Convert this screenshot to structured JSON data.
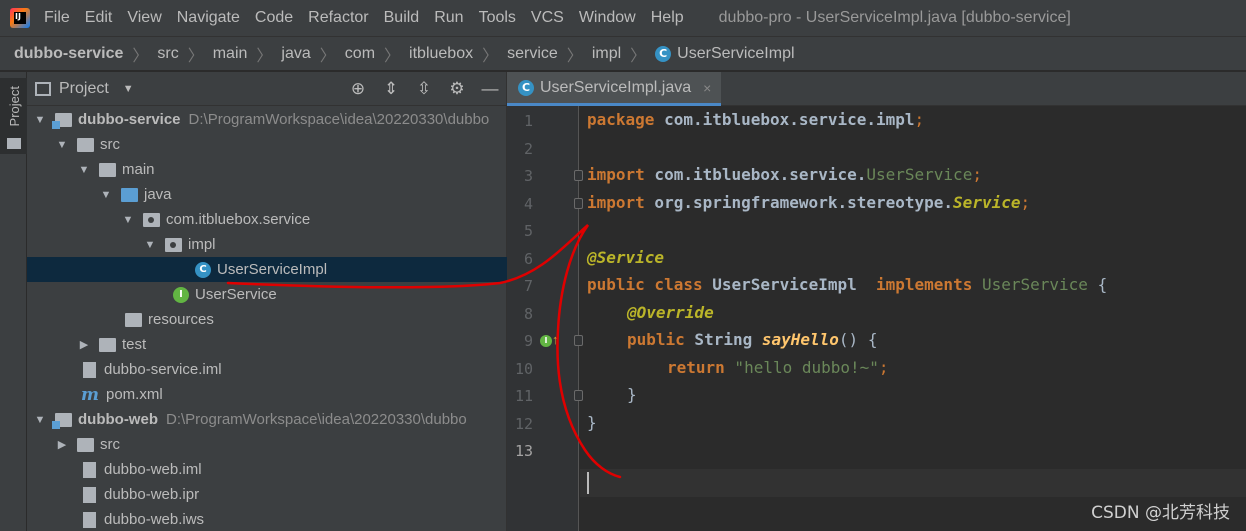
{
  "menubar": {
    "logo": "IJ",
    "items": [
      "File",
      "Edit",
      "View",
      "Navigate",
      "Code",
      "Refactor",
      "Build",
      "Run",
      "Tools",
      "VCS",
      "Window",
      "Help"
    ],
    "window_title": "dubbo-pro - UserServiceImpl.java [dubbo-service]"
  },
  "breadcrumb": {
    "items": [
      "dubbo-service",
      "src",
      "main",
      "java",
      "com",
      "itbluebox",
      "service",
      "impl"
    ],
    "current": "UserServiceImpl",
    "current_icon": "C"
  },
  "toolstrip": {
    "project_label": "Project"
  },
  "project_panel": {
    "title": "Project",
    "tools": [
      "locate-icon",
      "expand-all-icon",
      "collapse-all-icon",
      "gear-icon",
      "minimize-icon"
    ],
    "tree": [
      {
        "label": "dubbo-service",
        "path": "D:\\ProgramWorkspace\\idea\\20220330\\dubbo",
        "kind": "module",
        "expanded": true,
        "level": 0
      },
      {
        "label": "src",
        "kind": "folder",
        "expanded": true,
        "level": 1
      },
      {
        "label": "main",
        "kind": "folder",
        "expanded": true,
        "level": 2
      },
      {
        "label": "java",
        "kind": "source-folder",
        "expanded": true,
        "level": 3
      },
      {
        "label": "com.itbluebox.service",
        "kind": "package",
        "expanded": true,
        "level": 4
      },
      {
        "label": "impl",
        "kind": "package",
        "expanded": true,
        "level": 5
      },
      {
        "label": "UserServiceImpl",
        "kind": "class",
        "level": 6,
        "selected": true,
        "icon": "C"
      },
      {
        "label": "UserService",
        "kind": "interface",
        "level": 5,
        "icon": "I"
      },
      {
        "label": "resources",
        "kind": "resources-folder",
        "level": 3
      },
      {
        "label": "test",
        "kind": "folder",
        "expanded": false,
        "level": 2
      },
      {
        "label": "dubbo-service.iml",
        "kind": "file",
        "level": 2
      },
      {
        "label": "pom.xml",
        "kind": "maven",
        "level": 2,
        "icon": "m"
      },
      {
        "label": "dubbo-web",
        "path": "D:\\ProgramWorkspace\\idea\\20220330\\dubbo",
        "kind": "module",
        "expanded": true,
        "level": 0
      },
      {
        "label": "src",
        "kind": "folder",
        "expanded": false,
        "level": 1
      },
      {
        "label": "dubbo-web.iml",
        "kind": "file",
        "level": 2
      },
      {
        "label": "dubbo-web.ipr",
        "kind": "file",
        "level": 2
      },
      {
        "label": "dubbo-web.iws",
        "kind": "file",
        "level": 2
      }
    ]
  },
  "editor": {
    "tab": {
      "label": "UserServiceImpl.java",
      "icon": "C",
      "close": "×"
    },
    "line_numbers": [
      "1",
      "2",
      "3",
      "4",
      "5",
      "6",
      "7",
      "8",
      "9",
      "10",
      "11",
      "12",
      "13"
    ],
    "current_line": "13",
    "gutter_icon": "I",
    "gutter_arrow": "↑",
    "code": {
      "l1_kw": "package",
      "l1_rest": " com.itbluebox.service.impl",
      "l1_semi": ";",
      "l3_kw": "import",
      "l3_pkg": " com.itbluebox.service.",
      "l3_cls": "UserService",
      "l3_semi": ";",
      "l4_kw": "import",
      "l4_pkg": " org.springframework.stereotype.",
      "l4_cls": "Service",
      "l4_semi": ";",
      "l6_ann": "@Service",
      "l7_kw1": "public",
      "l7_kw2": " class ",
      "l7_cls": "UserServiceImpl",
      "l7_kw3": "  implements ",
      "l7_ifc": "UserService",
      "l7_rest": " {",
      "l8_ann": "@Override",
      "l9_kw": "public",
      "l9_type": " String ",
      "l9_meth": "sayHello",
      "l9_rest": "() {",
      "l10_kw": "return",
      "l10_str": " \"hello dubbo!~\"",
      "l10_semi": ";",
      "l11": "}",
      "l12": "}"
    }
  },
  "watermark": "CSDN @北芳科技",
  "colors": {
    "background": "#2b2b2b",
    "panel": "#3c3f41",
    "selection": "#0d293e",
    "keyword": "#cc7832",
    "annotation": "#bbb529",
    "string": "#6a8759",
    "method": "#ffc66d",
    "red_annotation": "#e00000"
  }
}
